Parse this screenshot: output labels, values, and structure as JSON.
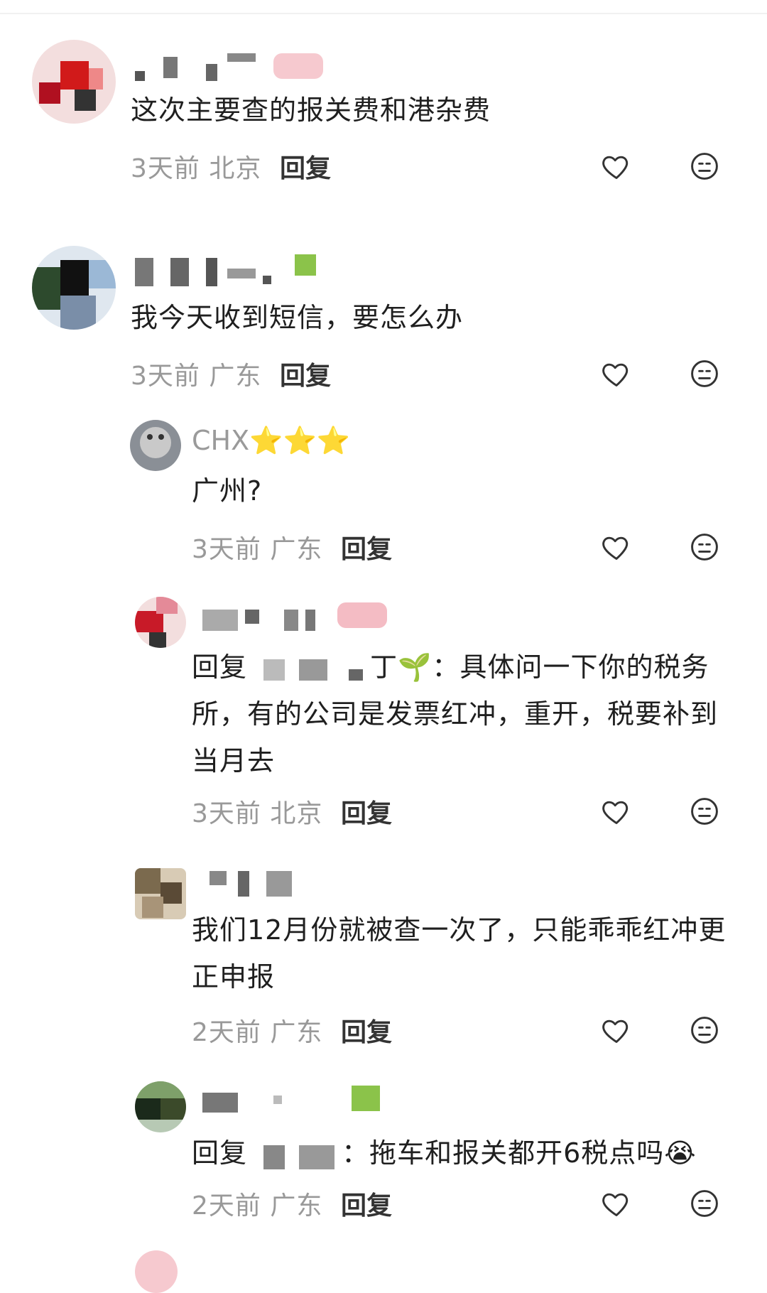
{
  "comments": [
    {
      "text": "这次主要查的报关费和港杂费",
      "time": "3天前",
      "location": "北京",
      "reply_label": "回复"
    },
    {
      "text": "我今天收到短信，要怎么办",
      "time": "3天前",
      "location": "广东",
      "reply_label": "回复"
    },
    {
      "username": "CHX",
      "stars": "⭐⭐⭐",
      "text": "广州?",
      "time": "3天前",
      "location": "广东",
      "reply_label": "回复"
    },
    {
      "reply_prefix": "回复",
      "reply_target_suffix": "丁🌱：",
      "text": "具体问一下你的税务所，有的公司是发票红冲，重开，税要补到当月去",
      "time": "3天前",
      "location": "北京",
      "reply_label": "回复"
    },
    {
      "text": "我们12月份就被查一次了，只能乖乖红冲更正申报",
      "time": "2天前",
      "location": "广东",
      "reply_label": "回复"
    },
    {
      "reply_prefix": "回复",
      "text": "：拖车和报关都开6税点吗😭",
      "time": "2天前",
      "location": "广东",
      "reply_label": "回复"
    }
  ],
  "colors": {
    "meta_gray": "#999999",
    "text_dark": "#1f1f1f",
    "star_gold": "#f5b800"
  },
  "icons": {
    "like": "heart-outline-icon",
    "dislike": "neutral-face-icon"
  }
}
